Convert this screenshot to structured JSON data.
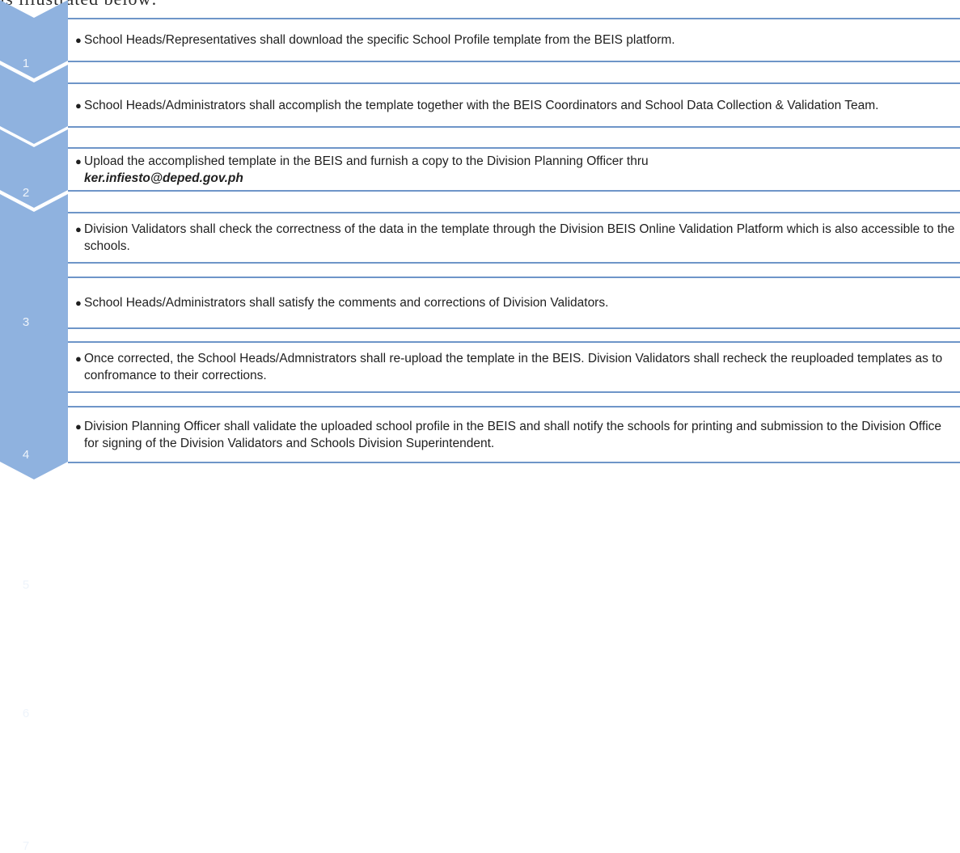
{
  "intro_text": "is illustrated below:",
  "colors": {
    "chevron": "#8fb2df",
    "rule": "#6e95c8",
    "number": "#eef4fb"
  },
  "steps": [
    {
      "number": "1",
      "text": "School Heads/Representatives shall download the specific School Profile template from the BEIS platform.",
      "email": ""
    },
    {
      "number": "2",
      "text": "School Heads/Administrators shall accomplish the template together with the BEIS Coordinators and School Data Collection & Validation Team.",
      "email": ""
    },
    {
      "number": "3",
      "text": "Upload the accomplished template in the BEIS and furnish a copy to the Division Planning Officer thru",
      "email": "ker.infiesto@deped.gov.ph"
    },
    {
      "number": "4",
      "text": "Division Validators shall check the correctness of the data in the template through the Division BEIS Online Validation Platform which is also accessible to the schools.",
      "email": ""
    },
    {
      "number": "5",
      "text": "School Heads/Administrators shall satisfy the comments and corrections of Division Validators.",
      "email": ""
    },
    {
      "number": "6",
      "text": "Once corrected, the School Heads/Admnistrators shall re-upload the template in the BEIS. Division Validators shall recheck the reuploaded templates as to confromance to their corrections.",
      "email": ""
    },
    {
      "number": "7",
      "text": "Division Planning Officer shall validate the uploaded school profile in the BEIS and shall notify the schools for printing and submission to the Division Office for signing of the Division Validators and Schools Division Superintendent.",
      "email": ""
    }
  ]
}
